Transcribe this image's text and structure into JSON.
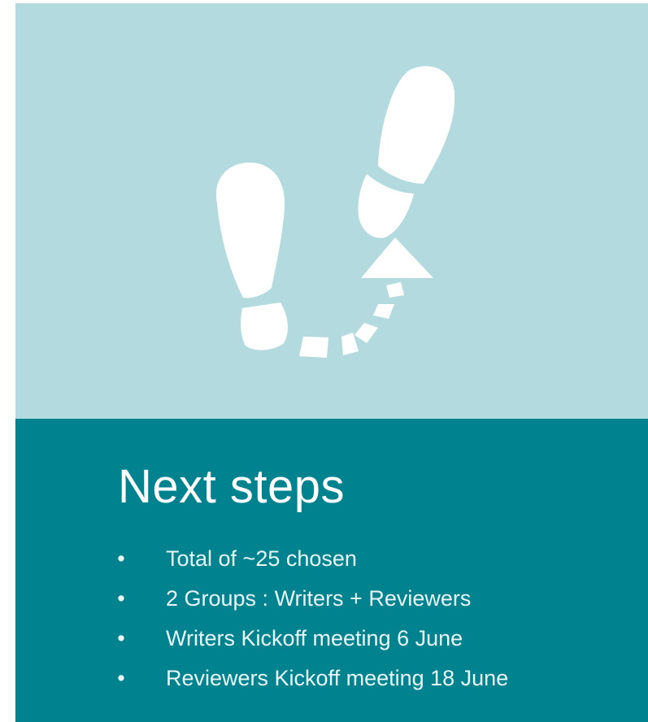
{
  "illustration": {
    "icon": "footsteps-icon",
    "background_color": "#b3dbdf",
    "foreground_color": "#ffffff"
  },
  "content": {
    "background_color": "#00838f",
    "title": "Next steps",
    "bullet_marker": "•",
    "bullets": [
      "Total of ~25 chosen",
      "2 Groups : Writers + Reviewers",
      "Writers Kickoff meeting 6 June",
      "Reviewers Kickoff meeting 18 June"
    ]
  }
}
